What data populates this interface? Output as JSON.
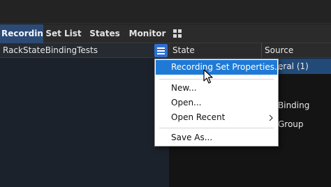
{
  "tabs": [
    {
      "label": "Recordin...",
      "active": true
    },
    {
      "label": "Set List",
      "active": false
    },
    {
      "label": "States",
      "active": false
    },
    {
      "label": "Monitor",
      "active": false
    }
  ],
  "left_panel": {
    "title": "RackStateBindingTests",
    "menu_icon": "hamburger-icon"
  },
  "table": {
    "columns": [
      "State",
      "Source"
    ],
    "source_cells": [
      "eral (1)",
      "Binding",
      "Group"
    ]
  },
  "dropdown_menu": {
    "items": [
      {
        "label": "Recording Set Properties...",
        "highlighted": true
      },
      {
        "label": "New..."
      },
      {
        "label": "Open..."
      },
      {
        "label": "Open Recent",
        "submenu": true
      },
      {
        "label": "Save As..."
      }
    ],
    "submenu_icon": "chevron-right-icon"
  },
  "colors": {
    "accent": "#2f6fd0",
    "highlight": "#1f7ad6",
    "active_tab": "#2c4a74",
    "selected_row": "#224a78"
  }
}
